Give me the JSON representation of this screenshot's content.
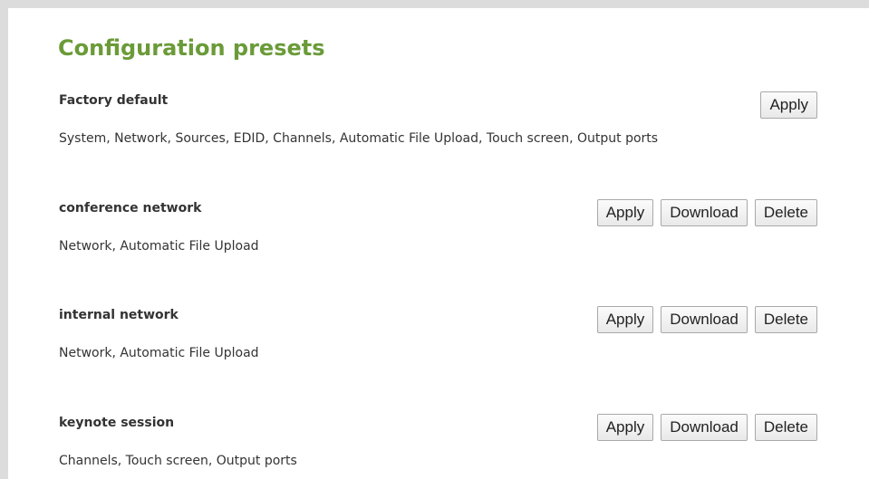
{
  "panel": {
    "title": "Configuration presets"
  },
  "presets": [
    {
      "name": "Factory default",
      "description": "System, Network, Sources, EDID, Channels, Automatic File Upload, Touch screen, Output ports",
      "apply_label": "Apply"
    },
    {
      "name": "conference network",
      "description": "Network, Automatic File Upload",
      "apply_label": "Apply",
      "download_label": "Download",
      "delete_label": "Delete"
    },
    {
      "name": "internal network",
      "description": "Network, Automatic File Upload",
      "apply_label": "Apply",
      "download_label": "Download",
      "delete_label": "Delete"
    },
    {
      "name": "keynote session",
      "description": "Channels, Touch screen, Output ports",
      "apply_label": "Apply",
      "download_label": "Download",
      "delete_label": "Delete"
    }
  ],
  "colors": {
    "title_green": "#6a9b38",
    "frame_gray": "#dcdcdc",
    "text": "#333333"
  }
}
